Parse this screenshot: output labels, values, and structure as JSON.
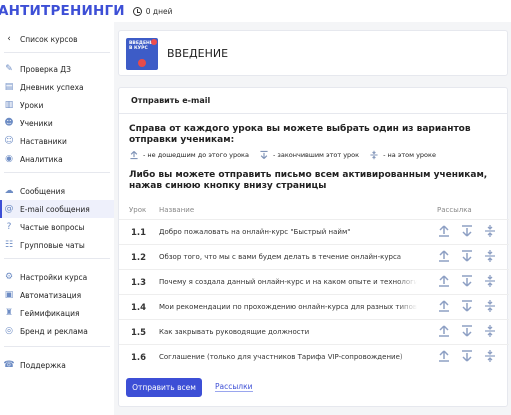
{
  "header": {
    "logo": "АНТИТРЕНИНГИ",
    "days": "0 дней"
  },
  "sidebar": {
    "back": "Список курсов",
    "items": [
      {
        "label": "Проверка ДЗ",
        "icon": "edit-icon"
      },
      {
        "label": "Дневник успеха",
        "icon": "diary-icon"
      },
      {
        "label": "Уроки",
        "icon": "book-icon"
      },
      {
        "label": "Ученики",
        "icon": "students-icon"
      },
      {
        "label": "Наставники",
        "icon": "mentors-icon"
      },
      {
        "label": "Аналитика",
        "icon": "analytics-icon"
      },
      {
        "label": "Сообщения",
        "icon": "messages-icon"
      },
      {
        "label": "E-mail сообщения",
        "icon": "at-icon"
      },
      {
        "label": "Частые вопросы",
        "icon": "question-icon"
      },
      {
        "label": "Групповые чаты",
        "icon": "group-chat-icon"
      },
      {
        "label": "Настройки курса",
        "icon": "settings-icon"
      },
      {
        "label": "Автоматизация",
        "icon": "robot-icon"
      },
      {
        "label": "Геймификация",
        "icon": "gamification-icon"
      },
      {
        "label": "Бренд и реклама",
        "icon": "brand-icon"
      },
      {
        "label": "Поддержка",
        "icon": "phone-icon"
      }
    ]
  },
  "lesson": {
    "title": "ВВЕДЕНИЕ",
    "thumb_text": "ВВЕДЕНИЕ В КУРС"
  },
  "panel": {
    "title": "Отправить e-mail",
    "intro": "Справа от каждого урока вы можете выбрать один из вариантов отправки ученикам:",
    "legend": [
      {
        "icon": "upload-up-icon",
        "text": "- не дошедшим до этого урока"
      },
      {
        "icon": "download-down-icon",
        "text": "- закончившим этот урок"
      },
      {
        "icon": "on-lesson-icon",
        "text": "- на этом уроке"
      }
    ],
    "intro2": "Либо вы можете отправить письмо всем активированным ученикам, нажав синюю кнопку внизу страницы",
    "columns": {
      "lesson": "Урок",
      "name": "Название",
      "send": "Рассылка"
    },
    "rows": [
      {
        "num": "1.1",
        "name": "Добро пожаловать на онлайн-курс \"Быстрый найм\""
      },
      {
        "num": "1.2",
        "name": "Обзор того, что мы с вами будем делать в течение онлайн-курса"
      },
      {
        "num": "1.3",
        "name": "Почему я создала данный онлайн-курс и на каком опыте и технологиях он основан"
      },
      {
        "num": "1.4",
        "name": "Мои рекомендации по прохождению онлайн-курса для разных типов учеников"
      },
      {
        "num": "1.5",
        "name": "Как закрывать руководящие должности"
      },
      {
        "num": "1.6",
        "name": "Соглашение (только для участников Тарифа VIP-сопровождение)"
      }
    ],
    "send_all": "Отправить всем",
    "mailings": "Рассылки"
  },
  "colors": {
    "accent": "#3d4fd6",
    "icon": "#6d8cc4"
  }
}
